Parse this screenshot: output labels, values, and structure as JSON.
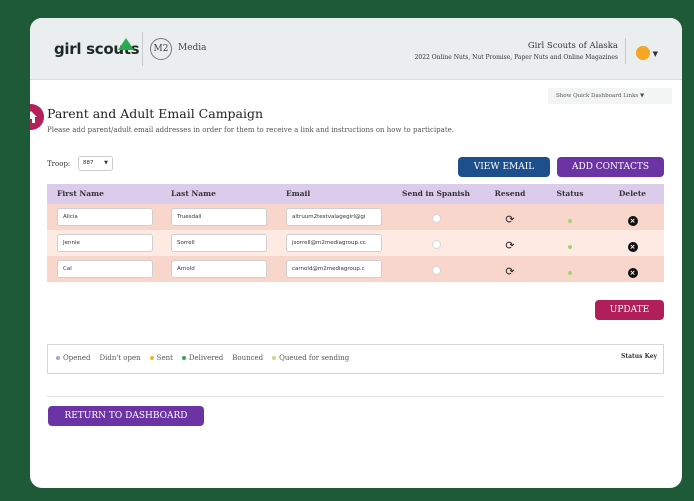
{
  "header": {
    "logo_text": "girl scouts",
    "m2_badge": "M2",
    "media_label": "Media",
    "council_name": "Girl Scouts of Alaska",
    "campaign_name": "2022 Online Nuts, Nut Promise, Paper Nuts and Online Magazines",
    "quick_links": "Show Quick Dashboard Links ▼"
  },
  "page": {
    "title": "Parent and Adult Email Campaign",
    "subtitle": "Please add parent/adult email addresses in order for them to receive a link and instructions on how to participate."
  },
  "troop": {
    "label": "Troop:",
    "value": "887"
  },
  "buttons": {
    "view_email": "VIEW EMAIL",
    "add_contacts": "ADD CONTACTS",
    "update": "UPDATE",
    "return_dashboard": "RETURN TO DASHBOARD"
  },
  "table": {
    "headers": [
      "First Name",
      "Last Name",
      "Email",
      "Send in Spanish",
      "Resend",
      "Status",
      "Delete"
    ],
    "rows": [
      {
        "first": "Alicia",
        "last": "Truesdail",
        "email": "altruum2testvalagegirl@gi"
      },
      {
        "first": "Jennie",
        "last": "Sorrell",
        "email": "jsorrell@m2mediagroup.cc"
      },
      {
        "first": "Cal",
        "last": "Arnold",
        "email": "carnold@m2mediagroup.c"
      }
    ]
  },
  "status_key": {
    "title": "Status Key",
    "items": [
      {
        "label": "Opened",
        "color": "#b59ad6"
      },
      {
        "label": "Didn't open",
        "color": ""
      },
      {
        "label": "Sent",
        "color": "#f5b72a"
      },
      {
        "label": "Delivered",
        "color": "#2aa94f"
      },
      {
        "label": "Bounced",
        "color": ""
      },
      {
        "label": "Queued for sending",
        "color": "#c9d98a"
      }
    ]
  },
  "colors": {
    "background": "#1f5a38",
    "view_email": "#1d4f8c",
    "purple": "#6b33a3",
    "magenta": "#b01f5a",
    "table_header": "#dcccec",
    "row_dark": "#f9d6cc",
    "row_light": "#fdeae3"
  },
  "icons": {
    "home": "home-icon",
    "resend": "refresh-icon",
    "delete": "close-circle-icon",
    "logo": "trefoil-icon",
    "user": "user-avatar-icon"
  }
}
